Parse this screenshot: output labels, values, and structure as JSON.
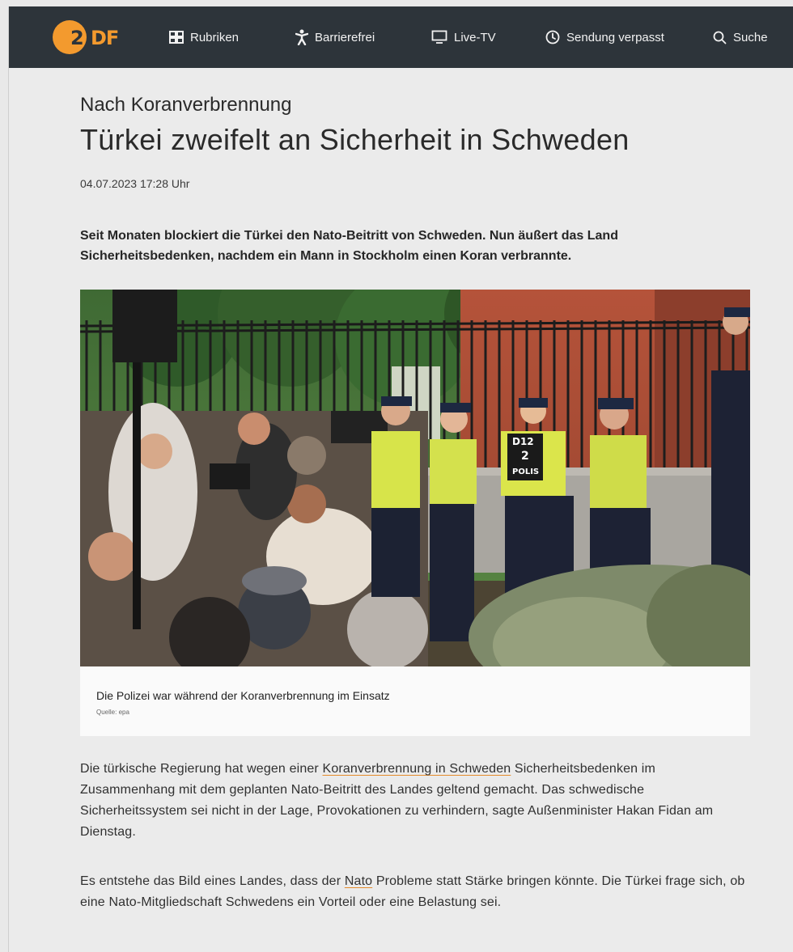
{
  "nav": {
    "logo_left": "2",
    "logo_right": "DF",
    "items": [
      {
        "label": "Rubriken",
        "icon": "grid-icon"
      },
      {
        "label": "Barrierefrei",
        "icon": "accessibility-icon"
      },
      {
        "label": "Live-TV",
        "icon": "tv-icon"
      },
      {
        "label": "Sendung verpasst",
        "icon": "clock-icon"
      },
      {
        "label": "Suche",
        "icon": "search-icon"
      }
    ]
  },
  "article": {
    "kicker": "Nach Koranverbrennung",
    "headline": "Türkei zweifelt an Sicherheit in Schweden",
    "date": "04.07.2023 17:28 Uhr",
    "lead": "Seit Monaten blockiert die Türkei den Nato-Beitritt von Schweden. Nun äußert das Land Sicherheitsbedenken, nachdem ein Mann in Stockholm einen Koran verbrannte.",
    "image": {
      "caption": "Die Polizei war während der Koranverbrennung im Einsatz",
      "source": "Quelle: epa",
      "vest_text_1": "D12",
      "vest_text_2": "2",
      "vest_text_3": "POLIS"
    },
    "p1_before": "Die türkische Regierung hat wegen einer ",
    "p1_link": "Koranverbrennung in Schweden",
    "p1_after": " Sicherheitsbe­denken im Zusammenhang mit dem geplanten Nato-Beitritt des Landes geltend gemacht. Das schwedische Sicherheitssystem sei nicht in der Lage, Provokationen zu verhindern, sagte Außenminister Hakan Fidan am Dienstag.",
    "p2_before": "Es entstehe das Bild eines Landes, dass der ",
    "p2_link": "Nato",
    "p2_after": " Probleme statt Stärke bringen könnte. Die Türkei frage sich, ob eine Nato-Mitgliedschaft Schwedens ein Vorteil oder eine Belas­tung sei."
  },
  "colors": {
    "nav_bg": "#2d343a",
    "brand_orange": "#f39a2e",
    "page_bg": "#ebebeb"
  }
}
